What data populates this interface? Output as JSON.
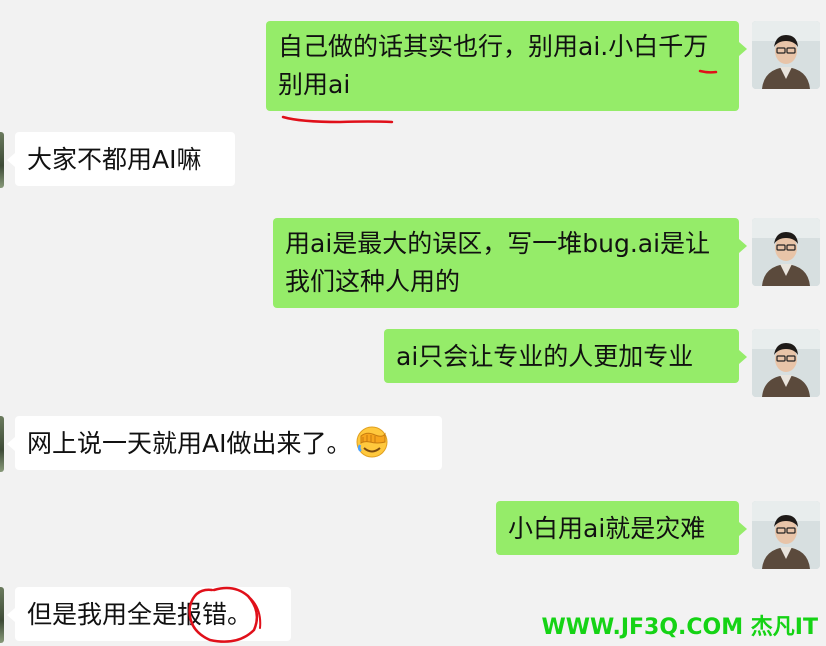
{
  "messages": [
    {
      "side": "sent",
      "text": "自己做的话其实也行，别用ai.小白千万别用ai"
    },
    {
      "side": "recv",
      "text": "大家不都用AI嘛"
    },
    {
      "side": "sent",
      "text": "用ai是最大的误区，写一堆bug.ai是让我们这种人用的"
    },
    {
      "side": "sent",
      "text": "ai只会让专业的人更加专业"
    },
    {
      "side": "recv",
      "text": "网上说一天就用AI做出来了。",
      "emoji": "face-with-hand-over-eyes-emoji"
    },
    {
      "side": "sent",
      "text": "小白用ai就是灾难"
    },
    {
      "side": "recv",
      "text": "但是我用全是报错。"
    }
  ],
  "watermark": "WWW.JF3Q.COM 杰凡IT",
  "colors": {
    "background": "#f2f2f2",
    "sent_bubble": "#95ec69",
    "recv_bubble": "#ffffff",
    "annotation": "#e0101a",
    "watermark": "#15d315"
  }
}
